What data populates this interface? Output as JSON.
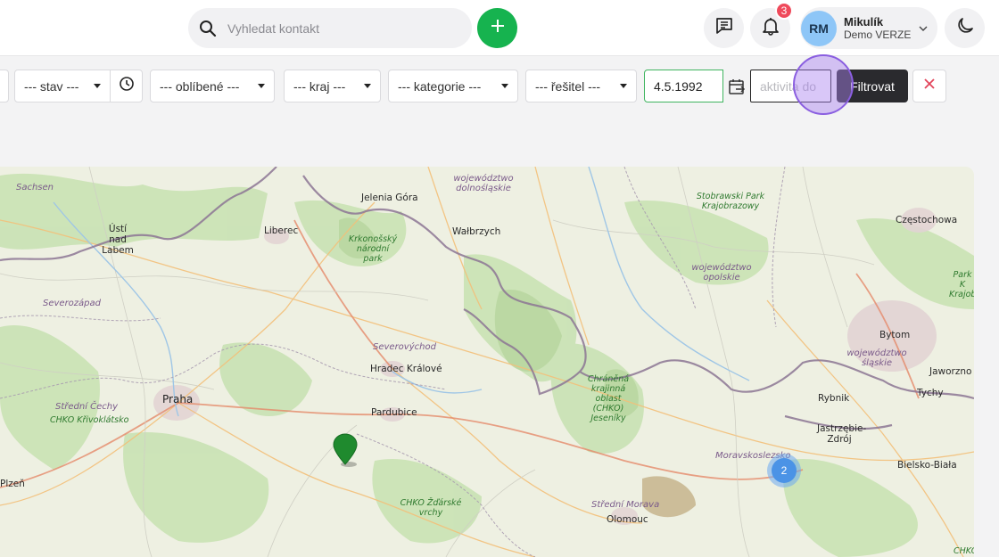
{
  "header": {
    "search_placeholder": "Vyhledat kontakt",
    "notifications_count": "3",
    "user": {
      "initials": "RM",
      "name": "Mikulík",
      "org": "Demo VERZE"
    }
  },
  "filters": {
    "partial_select": "",
    "stav": "--- stav ---",
    "oblibene": "--- oblíbené ---",
    "kraj": "--- kraj ---",
    "kategorie": "--- kategorie ---",
    "resitel": "--- řešitel ---",
    "date_from": "4.5.1992",
    "date_to_placeholder": "aktivita do",
    "filter_button": "Filtrovat"
  },
  "colors": {
    "accent_green": "#16b34f",
    "badge_red": "#ef4a5b",
    "cluster_blue": "#4b93e6",
    "marker_green": "#1f8a2e"
  },
  "map": {
    "cities": [
      {
        "name": "Jelenia Góra"
      },
      {
        "name": "Liberec"
      },
      {
        "name": "Ústí nad Labem"
      },
      {
        "name": "Wałbrzych"
      },
      {
        "name": "Hradec Králové"
      },
      {
        "name": "Praha"
      },
      {
        "name": "Pardubice"
      },
      {
        "name": "Plzeň"
      },
      {
        "name": "Olomouc"
      },
      {
        "name": "Bytom"
      },
      {
        "name": "Jaworzno"
      },
      {
        "name": "Tychy"
      },
      {
        "name": "Rybnik"
      },
      {
        "name": "Jastrzębie-Zdrój"
      },
      {
        "name": "Bielsko-Biała"
      },
      {
        "name": "Częstochowa"
      }
    ],
    "regions": [
      {
        "name": "Sachsen"
      },
      {
        "name": "województwo dolnośląskie"
      },
      {
        "name": "Severozápad"
      },
      {
        "name": "Severovýchod"
      },
      {
        "name": "Střední Čechy"
      },
      {
        "name": "województwo opolskie"
      },
      {
        "name": "województwo śląskie"
      },
      {
        "name": "Moravskoslezsko"
      },
      {
        "name": "Střední Morava"
      }
    ],
    "parks": [
      {
        "name": "Krkonošský národní park"
      },
      {
        "name": "Stobrawski Park Krajobrazowy"
      },
      {
        "name": "CHKO Křivoklátsko"
      },
      {
        "name": "Chráněná krajinná oblast (CHKO) Jeseníky"
      },
      {
        "name": "CHKO Žďárské vrchy"
      },
      {
        "name": "Park K Krajob"
      },
      {
        "name": "CHKO Horn"
      }
    ],
    "cluster_count": "2"
  }
}
